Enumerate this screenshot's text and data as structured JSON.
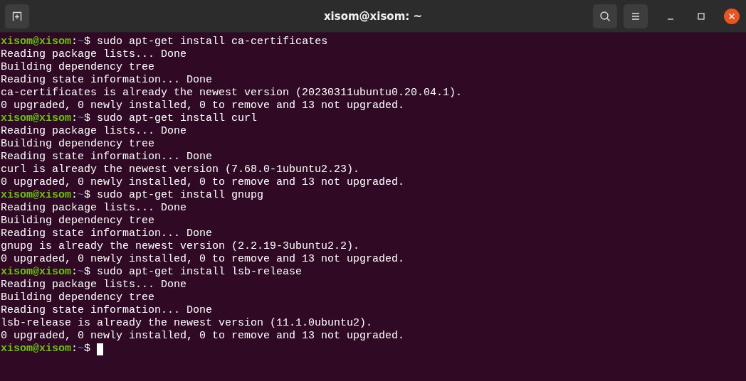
{
  "window": {
    "title": "xisom@xisom: ~"
  },
  "terminal": {
    "lines": [
      {
        "kind": "prompt",
        "user": "xisom@xisom",
        "separator": ":",
        "path": "~",
        "symbol": "$",
        "command": "sudo apt-get install ca-certificates"
      },
      {
        "kind": "output",
        "text": "Reading package lists... Done"
      },
      {
        "kind": "output",
        "text": "Building dependency tree"
      },
      {
        "kind": "output",
        "text": "Reading state information... Done"
      },
      {
        "kind": "output",
        "text": "ca-certificates is already the newest version (20230311ubuntu0.20.04.1)."
      },
      {
        "kind": "output",
        "text": "0 upgraded, 0 newly installed, 0 to remove and 13 not upgraded."
      },
      {
        "kind": "prompt",
        "user": "xisom@xisom",
        "separator": ":",
        "path": "~",
        "symbol": "$",
        "command": "sudo apt-get install curl"
      },
      {
        "kind": "output",
        "text": "Reading package lists... Done"
      },
      {
        "kind": "output",
        "text": "Building dependency tree"
      },
      {
        "kind": "output",
        "text": "Reading state information... Done"
      },
      {
        "kind": "output",
        "text": "curl is already the newest version (7.68.0-1ubuntu2.23)."
      },
      {
        "kind": "output",
        "text": "0 upgraded, 0 newly installed, 0 to remove and 13 not upgraded."
      },
      {
        "kind": "prompt",
        "user": "xisom@xisom",
        "separator": ":",
        "path": "~",
        "symbol": "$",
        "command": "sudo apt-get install gnupg"
      },
      {
        "kind": "output",
        "text": "Reading package lists... Done"
      },
      {
        "kind": "output",
        "text": "Building dependency tree"
      },
      {
        "kind": "output",
        "text": "Reading state information... Done"
      },
      {
        "kind": "output",
        "text": "gnupg is already the newest version (2.2.19-3ubuntu2.2)."
      },
      {
        "kind": "output",
        "text": "0 upgraded, 0 newly installed, 0 to remove and 13 not upgraded."
      },
      {
        "kind": "prompt",
        "user": "xisom@xisom",
        "separator": ":",
        "path": "~",
        "symbol": "$",
        "command": "sudo apt-get install lsb-release"
      },
      {
        "kind": "output",
        "text": "Reading package lists... Done"
      },
      {
        "kind": "output",
        "text": "Building dependency tree"
      },
      {
        "kind": "output",
        "text": "Reading state information... Done"
      },
      {
        "kind": "output",
        "text": "lsb-release is already the newest version (11.1.0ubuntu2)."
      },
      {
        "kind": "output",
        "text": "0 upgraded, 0 newly installed, 0 to remove and 13 not upgraded."
      },
      {
        "kind": "prompt",
        "user": "xisom@xisom",
        "separator": ":",
        "path": "~",
        "symbol": "$",
        "cursor": true
      }
    ]
  }
}
